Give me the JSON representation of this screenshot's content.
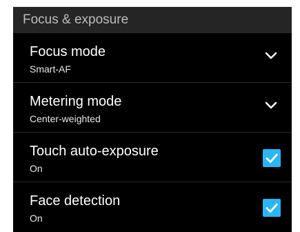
{
  "section": {
    "title": "Focus & exposure"
  },
  "rows": [
    {
      "title": "Focus mode",
      "value": "Smart-AF",
      "control": "dropdown"
    },
    {
      "title": "Metering mode",
      "value": "Center-weighted",
      "control": "dropdown"
    },
    {
      "title": "Touch auto-exposure",
      "value": "On",
      "control": "checkbox",
      "checked": true
    },
    {
      "title": "Face detection",
      "value": "On",
      "control": "checkbox",
      "checked": true
    }
  ],
  "colors": {
    "panel_background": "#000000",
    "header_background": "#252525",
    "checkbox_accent": "#29b6f6"
  }
}
